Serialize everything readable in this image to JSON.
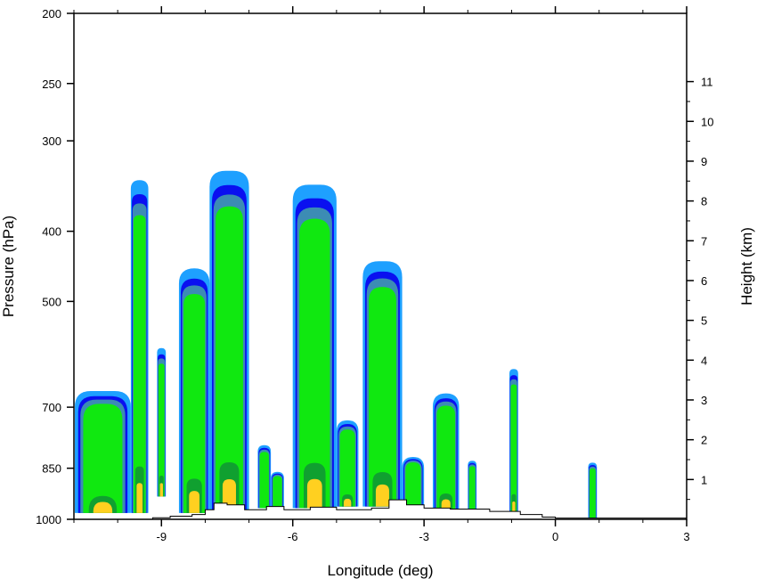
{
  "chart_data": {
    "type": "heatmap",
    "title": "",
    "xlabel": "Longitude (deg)",
    "ylabel": "Pressure (hPa)",
    "y2label": "Height (km)",
    "xlim": [
      -11.0,
      3.0
    ],
    "ylim": [
      1000,
      200
    ],
    "y_scale": "log",
    "grid": false,
    "legend": "none",
    "x_ticks": [
      {
        "value": -9,
        "label": "-9"
      },
      {
        "value": -6,
        "label": "-6"
      },
      {
        "value": -3,
        "label": "-3"
      },
      {
        "value": 0,
        "label": "0"
      },
      {
        "value": 3,
        "label": "3"
      }
    ],
    "y_ticks": [
      {
        "value": 200,
        "label": "200"
      },
      {
        "value": 250,
        "label": "250"
      },
      {
        "value": 300,
        "label": "300"
      },
      {
        "value": 400,
        "label": "400"
      },
      {
        "value": 500,
        "label": "500"
      },
      {
        "value": 700,
        "label": "700"
      },
      {
        "value": 850,
        "label": "850"
      },
      {
        "value": 1000,
        "label": "1000"
      }
    ],
    "y2_ticks": [
      {
        "value": 1,
        "label": "1"
      },
      {
        "value": 2,
        "label": "2"
      },
      {
        "value": 3,
        "label": "3"
      },
      {
        "value": 4,
        "label": "4"
      },
      {
        "value": 5,
        "label": "5"
      },
      {
        "value": 6,
        "label": "6"
      },
      {
        "value": 7,
        "label": "7"
      },
      {
        "value": 8,
        "label": "8"
      },
      {
        "value": 9,
        "label": "9"
      },
      {
        "value": 10,
        "label": "10"
      },
      {
        "value": 11,
        "label": "11"
      }
    ],
    "level_colors": [
      "#1ea0ff",
      "#0a10f0",
      "#3c8cb4",
      "#10e810",
      "#10a030",
      "#ffd020"
    ],
    "cells": [
      {
        "lon_min": -11.3,
        "lon_max": -9.7,
        "p_top": 665,
        "p_bottom": 980
      },
      {
        "lon_min": -9.7,
        "lon_max": -9.3,
        "p_top": 340,
        "p_bottom": 980
      },
      {
        "lon_min": -9.1,
        "lon_max": -8.9,
        "p_top": 580,
        "p_bottom": 930
      },
      {
        "lon_min": -8.6,
        "lon_max": -7.9,
        "p_top": 450,
        "p_bottom": 980
      },
      {
        "lon_min": -7.9,
        "lon_max": -7.0,
        "p_top": 330,
        "p_bottom": 970
      },
      {
        "lon_min": -6.8,
        "lon_max": -6.5,
        "p_top": 790,
        "p_bottom": 965
      },
      {
        "lon_min": -6.5,
        "lon_max": -6.2,
        "p_top": 860,
        "p_bottom": 975
      },
      {
        "lon_min": -6.0,
        "lon_max": -5.0,
        "p_top": 345,
        "p_bottom": 965
      },
      {
        "lon_min": -5.0,
        "lon_max": -4.5,
        "p_top": 730,
        "p_bottom": 960
      },
      {
        "lon_min": -4.4,
        "lon_max": -3.5,
        "p_top": 440,
        "p_bottom": 960
      },
      {
        "lon_min": -3.5,
        "lon_max": -3.0,
        "p_top": 820,
        "p_bottom": 965
      },
      {
        "lon_min": -2.8,
        "lon_max": -2.2,
        "p_top": 670,
        "p_bottom": 970
      },
      {
        "lon_min": -2.0,
        "lon_max": -1.8,
        "p_top": 830,
        "p_bottom": 980
      },
      {
        "lon_min": -1.05,
        "lon_max": -0.85,
        "p_top": 620,
        "p_bottom": 985
      },
      {
        "lon_min": 0.75,
        "lon_max": 0.95,
        "p_top": 835,
        "p_bottom": 995
      }
    ],
    "terrain": [
      {
        "lon": -9.5,
        "p": 1000
      },
      {
        "lon": -9.2,
        "p": 995
      },
      {
        "lon": -8.8,
        "p": 990
      },
      {
        "lon": -8.3,
        "p": 985
      },
      {
        "lon": -8.0,
        "p": 970
      },
      {
        "lon": -7.8,
        "p": 950
      },
      {
        "lon": -7.5,
        "p": 955
      },
      {
        "lon": -7.1,
        "p": 970
      },
      {
        "lon": -6.6,
        "p": 960
      },
      {
        "lon": -6.2,
        "p": 970
      },
      {
        "lon": -5.6,
        "p": 962
      },
      {
        "lon": -5.0,
        "p": 970
      },
      {
        "lon": -4.6,
        "p": 970
      },
      {
        "lon": -4.2,
        "p": 965
      },
      {
        "lon": -3.8,
        "p": 940
      },
      {
        "lon": -3.4,
        "p": 955
      },
      {
        "lon": -3.0,
        "p": 965
      },
      {
        "lon": -2.4,
        "p": 968
      },
      {
        "lon": -1.5,
        "p": 975
      },
      {
        "lon": -0.8,
        "p": 985
      },
      {
        "lon": -0.3,
        "p": 993
      },
      {
        "lon": 0.0,
        "p": 996
      },
      {
        "lon": 3.0,
        "p": 998
      }
    ]
  }
}
